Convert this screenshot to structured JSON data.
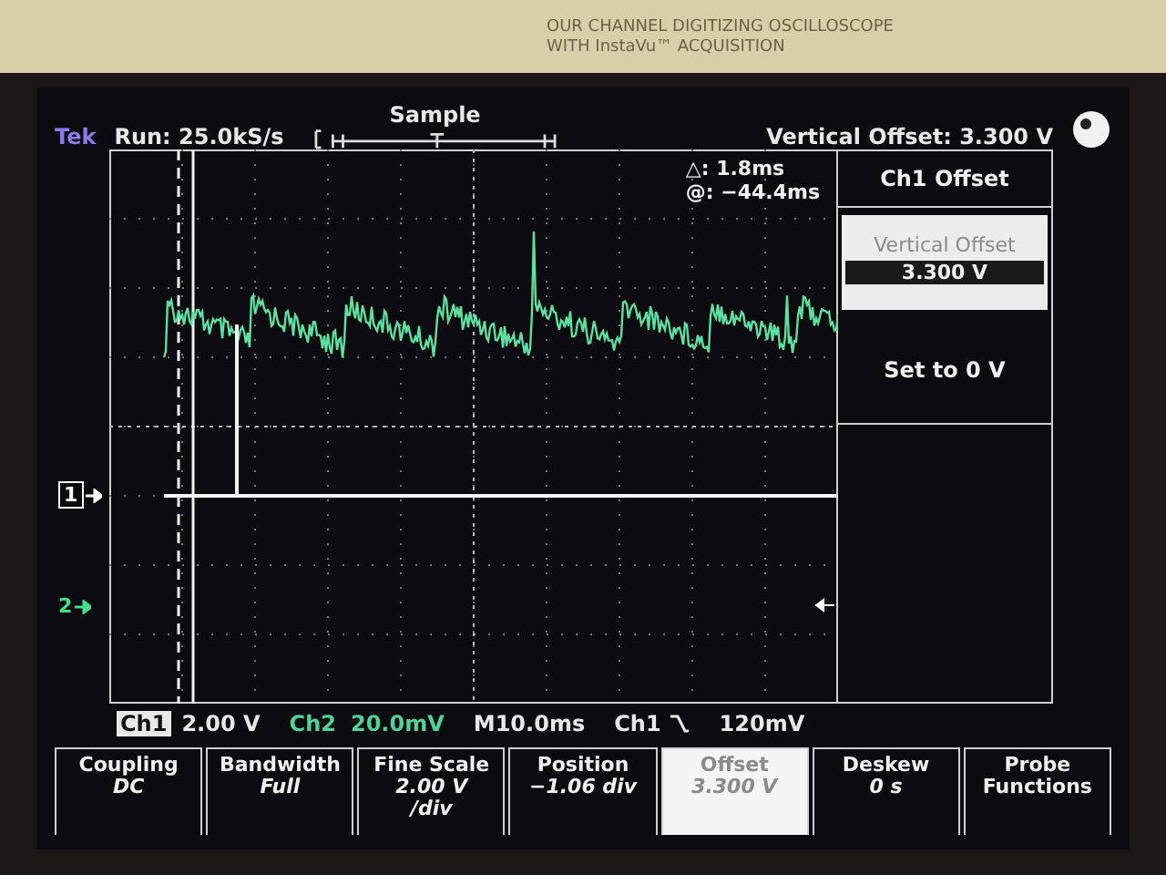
{
  "bezel": {
    "line_1": "OUR CHANNEL DIGITIZING OSCILLOSCOPE",
    "line_2": "WITH InstaVu™ ACQUISITION"
  },
  "header": {
    "brand": "Tek",
    "status": "Run: 25.0kS/s",
    "acquisition_mode": "Sample",
    "vertical_offset": "Vertical Offset: 3.300 V"
  },
  "cursor_readout": {
    "delta": "△: 1.8ms",
    "at": "@: −44.4ms"
  },
  "channel_markers": [
    {
      "label": "1",
      "color": "#ffffff"
    },
    {
      "label": "2",
      "color": "#3fe08a"
    }
  ],
  "side_menu": {
    "title": "Ch1 Offset",
    "field_label": "Vertical Offset",
    "field_value": "3.300 V",
    "action": "Set to 0 V"
  },
  "status_line": {
    "ch1_label": "Ch1",
    "ch1_scale": "2.00 V",
    "ch2_label": "Ch2",
    "ch2_scale": "20.0mV",
    "timebase": "M10.0ms",
    "trigger_source": "Ch1",
    "trigger_level": "120mV"
  },
  "menu_buttons": [
    {
      "title": "Coupling",
      "value": [
        "DC"
      ],
      "selected": false
    },
    {
      "title": "Bandwidth",
      "value": [
        "Full"
      ],
      "selected": false
    },
    {
      "title": "Fine Scale",
      "value": [
        "2.00 V",
        "/div"
      ],
      "selected": false
    },
    {
      "title": "Position",
      "value": [
        "−1.06 div"
      ],
      "selected": false
    },
    {
      "title": "Offset",
      "value": [
        "3.300 V"
      ],
      "selected": true
    },
    {
      "title": "Deskew",
      "value": [
        "0 s"
      ],
      "selected": false
    },
    {
      "title": "Probe Functions",
      "selected": false
    }
  ]
}
